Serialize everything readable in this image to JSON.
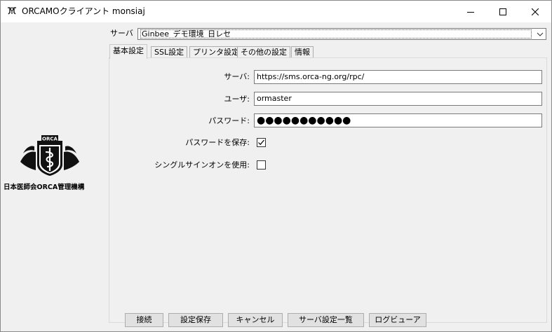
{
  "window": {
    "title": "ORCAMOクライアント monsiaj",
    "minimize_icon": "minimize-icon",
    "maximize_icon": "maximize-icon",
    "close_icon": "close-icon"
  },
  "logo": {
    "emblem_text": "ORCA",
    "caption": "日本医師会ORCA管理機構"
  },
  "server": {
    "label": "サーバ",
    "selected": "Ginbee_デモ環境_日レセ"
  },
  "tabs": [
    {
      "label": "基本設定",
      "active": true
    },
    {
      "label": "SSL設定",
      "active": false
    },
    {
      "label": "プリンタ設定",
      "active": false
    },
    {
      "label": "その他の設定",
      "active": false
    },
    {
      "label": "情報",
      "active": false
    }
  ],
  "form": {
    "server_label": "サーバ:",
    "server_value": "https://sms.orca-ng.org/rpc/",
    "user_label": "ユーザ:",
    "user_value": "ormaster",
    "password_label": "パスワード:",
    "password_value": "●●●●●●●●●●●",
    "save_password_label": "パスワードを保存:",
    "save_password_checked": true,
    "sso_label": "シングルサインオンを使用:",
    "sso_checked": false
  },
  "buttons": {
    "connect": "接続",
    "save_settings": "設定保存",
    "cancel": "キャンセル",
    "server_list": "サーバ設定一覧",
    "log_viewer": "ログビューア"
  }
}
